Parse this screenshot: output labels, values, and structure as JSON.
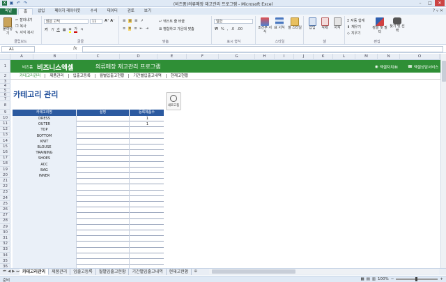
{
  "window": {
    "title": "(비즈폼)의류매장 재고관리 프로그램 - Microsoft Excel"
  },
  "ribbon_tabs": [
    "파일",
    "홈",
    "삽입",
    "페이지 레이아웃",
    "수식",
    "데이터",
    "검토",
    "보기"
  ],
  "ribbon": {
    "clipboard": {
      "paste": "붙여넣기",
      "cut": "잘라내기",
      "copy": "복사",
      "format_painter": "서식 복사",
      "label": "클립보드"
    },
    "font": {
      "name": "맑은 고딕",
      "size": "11",
      "label": "글꼴"
    },
    "alignment": {
      "wrap": "텍스트 줄 바꿈",
      "merge": "병합하고 가운데 맞춤",
      "label": "맞춤"
    },
    "number": {
      "format": "일반",
      "label": "표시 형식"
    },
    "styles": {
      "conditional": "조건부 서식",
      "table": "표 서식",
      "cell": "셀 스타일",
      "label": "스타일"
    },
    "cells": {
      "insert": "삽입",
      "delete": "삭제",
      "format": "서식",
      "label": "셀"
    },
    "editing": {
      "autosum": "자동 합계",
      "fill": "채우기",
      "clear": "지우기",
      "sort": "정렬 및 필터",
      "find": "찾기 및 선택",
      "label": "편집"
    }
  },
  "formula_bar": {
    "name_box": "A1",
    "fx": "fx",
    "formula": ""
  },
  "columns": [
    "A",
    "B",
    "C",
    "D",
    "E",
    "F",
    "G",
    "H",
    "I",
    "J",
    "K",
    "L",
    "M",
    "N",
    "O"
  ],
  "rows": [
    "1",
    "2",
    "3",
    "4",
    "5",
    "6",
    "7",
    "8",
    "9",
    "10",
    "11",
    "12",
    "13",
    "14",
    "15",
    "16",
    "17",
    "18",
    "19",
    "20",
    "21",
    "22",
    "23",
    "24",
    "25",
    "26",
    "27",
    "28",
    "29",
    "30",
    "31",
    "32",
    "33",
    "34",
    "35",
    "36",
    "37",
    "38",
    "39",
    "40"
  ],
  "banner": {
    "brand_small": "비즈폼",
    "brand": "비즈니스엑셀",
    "title": "의류매장 재고관리 프로그램",
    "link1": "엑셀자치IN",
    "link2": "엑셀상담서비스"
  },
  "menu": [
    "카테고리관리",
    "제품관리",
    "입출고등록",
    "월별입출고현황",
    "기간별입출고내역",
    "현재고현황"
  ],
  "page_title": "카테고리 관리",
  "refresh_label": "새로고침",
  "table": {
    "headers": [
      "카테고리명",
      "설명",
      "등록제품수"
    ],
    "rows": [
      [
        "DRESS",
        "",
        "1"
      ],
      [
        "OUTER",
        "",
        "1"
      ],
      [
        "TOP",
        "",
        ""
      ],
      [
        "BOTTOM",
        "",
        ""
      ],
      [
        "KNIT",
        "",
        ""
      ],
      [
        "BLOUSE",
        "",
        ""
      ],
      [
        "TRAINING",
        "",
        ""
      ],
      [
        "SHOES",
        "",
        ""
      ],
      [
        "ACC",
        "",
        ""
      ],
      [
        "BAG",
        "",
        ""
      ],
      [
        "INNER",
        "",
        ""
      ],
      [
        "",
        "",
        ""
      ],
      [
        "",
        "",
        ""
      ],
      [
        "",
        "",
        ""
      ],
      [
        "",
        "",
        ""
      ],
      [
        "",
        "",
        ""
      ],
      [
        "",
        "",
        ""
      ],
      [
        "",
        "",
        ""
      ],
      [
        "",
        "",
        ""
      ],
      [
        "",
        "",
        ""
      ],
      [
        "",
        "",
        ""
      ],
      [
        "",
        "",
        ""
      ],
      [
        "",
        "",
        ""
      ],
      [
        "",
        "",
        ""
      ],
      [
        "",
        "",
        ""
      ],
      [
        "",
        "",
        ""
      ],
      [
        "",
        "",
        ""
      ]
    ]
  },
  "sheet_tabs": [
    "카테고리관리",
    "제품관리",
    "입출고등록",
    "월별입출고현황",
    "기간별입출고내역",
    "현재고현황"
  ],
  "status": {
    "ready": "준비",
    "zoom": "100%"
  }
}
